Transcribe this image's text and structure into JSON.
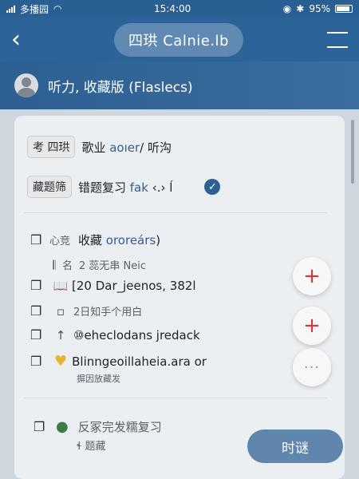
{
  "status": {
    "carrier": "多播园",
    "time": "15:4:00",
    "battery": "95%"
  },
  "appbar": {
    "title": "四珙 Calnie.lb"
  },
  "subbar": {
    "title": "听力, 收藏版 (Flaslecs)"
  },
  "rows": {
    "row1_tag": "考 四珙",
    "row1_text_a": "歌业 ",
    "row1_text_b": "aoıer",
    "row1_text_c": "/ 听沟",
    "row2_tag": "藏题筛",
    "row2_text_a": "错题复习 ",
    "row2_text_b": "fak",
    "row2_text_c": " ‹.›  ĺ"
  },
  "list": {
    "l1_prefix": "心竞",
    "l1_text_a": "收藏 ",
    "l1_text_b": "ororeárs",
    "l1_text_c": ")",
    "l2_prefix": "名",
    "l2_text": "2 蕊无串 Neic",
    "l3_text": "[20 Dar_jeenos, 382l",
    "l4_text": "2日知手个用白",
    "l5_text": "⑩eheclodans jredack",
    "l6_text": "Blinngeoillaheia.ara or",
    "l6_sub": "摒因放藏发"
  },
  "footer_item": {
    "title": "反冢完发糯复习",
    "sub": "ɬ 题藏"
  },
  "bottom_button": {
    "label": "时谜"
  },
  "fabs": {
    "add1": "+",
    "add2": "+",
    "more": "···"
  }
}
